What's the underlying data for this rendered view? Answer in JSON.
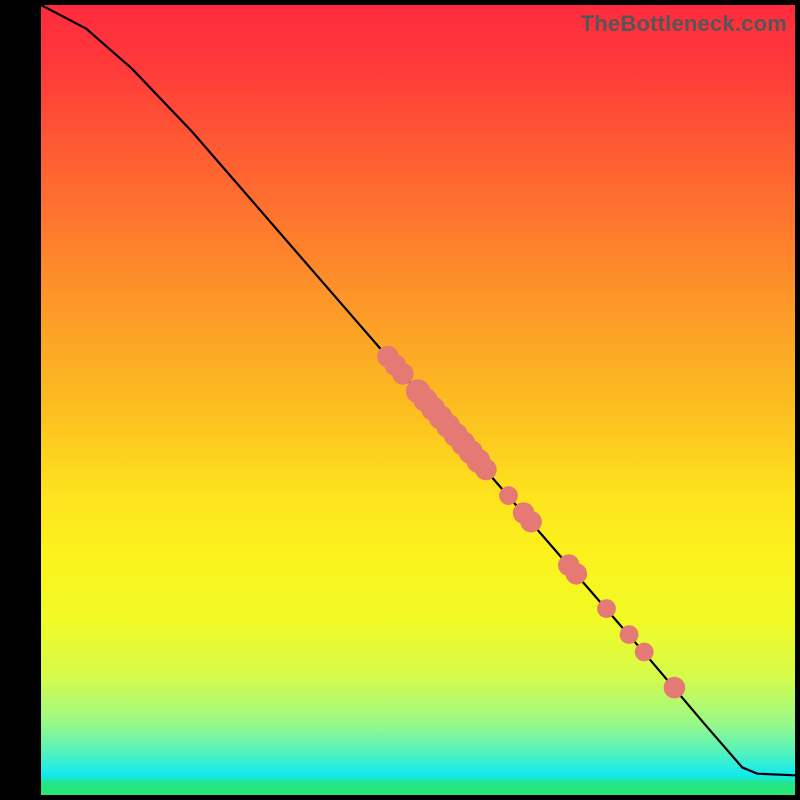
{
  "watermark": "TheBottleneck.com",
  "chart_data": {
    "type": "line",
    "title": "",
    "xlabel": "",
    "ylabel": "",
    "xlim": [
      0,
      100
    ],
    "ylim": [
      0,
      100
    ],
    "curve": [
      {
        "x": 0,
        "y": 100
      },
      {
        "x": 6,
        "y": 97
      },
      {
        "x": 12,
        "y": 92
      },
      {
        "x": 20,
        "y": 84
      },
      {
        "x": 30,
        "y": 73
      },
      {
        "x": 40,
        "y": 62
      },
      {
        "x": 50,
        "y": 51
      },
      {
        "x": 60,
        "y": 40
      },
      {
        "x": 70,
        "y": 29
      },
      {
        "x": 80,
        "y": 18
      },
      {
        "x": 88,
        "y": 9
      },
      {
        "x": 93,
        "y": 3.5
      },
      {
        "x": 95,
        "y": 2.7
      },
      {
        "x": 100,
        "y": 2.5
      }
    ],
    "markers": [
      {
        "x": 46,
        "y": 55.5,
        "r": 1.0
      },
      {
        "x": 47,
        "y": 54.4,
        "r": 1.0
      },
      {
        "x": 48,
        "y": 53.3,
        "r": 1.0
      },
      {
        "x": 50,
        "y": 51.1,
        "r": 1.2
      },
      {
        "x": 51,
        "y": 50.0,
        "r": 1.2
      },
      {
        "x": 52,
        "y": 48.9,
        "r": 1.2
      },
      {
        "x": 53,
        "y": 47.8,
        "r": 1.2
      },
      {
        "x": 54,
        "y": 46.7,
        "r": 1.2
      },
      {
        "x": 55,
        "y": 45.6,
        "r": 1.2
      },
      {
        "x": 56,
        "y": 44.5,
        "r": 1.2
      },
      {
        "x": 57,
        "y": 43.4,
        "r": 1.2
      },
      {
        "x": 58,
        "y": 42.3,
        "r": 1.2
      },
      {
        "x": 59,
        "y": 41.2,
        "r": 1.0
      },
      {
        "x": 62,
        "y": 37.9,
        "r": 0.8
      },
      {
        "x": 64,
        "y": 35.7,
        "r": 1.0
      },
      {
        "x": 65,
        "y": 34.6,
        "r": 1.0
      },
      {
        "x": 70,
        "y": 29.1,
        "r": 1.0
      },
      {
        "x": 71,
        "y": 28.0,
        "r": 1.0
      },
      {
        "x": 75,
        "y": 23.6,
        "r": 0.8
      },
      {
        "x": 78,
        "y": 20.3,
        "r": 0.8
      },
      {
        "x": 80,
        "y": 18.1,
        "r": 0.8
      },
      {
        "x": 84,
        "y": 13.6,
        "r": 1.0
      }
    ],
    "marker_color": "#e47a73",
    "line_color": "#000000"
  }
}
